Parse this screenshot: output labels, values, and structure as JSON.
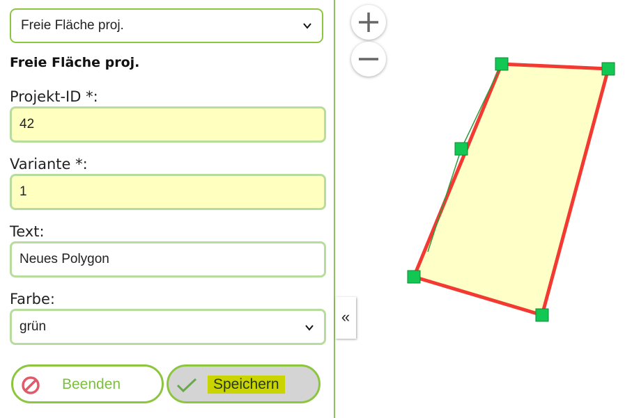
{
  "layer_select": {
    "value": "Freie Fläche proj."
  },
  "form": {
    "title": "Freie Fläche proj.",
    "projekt_id": {
      "label": "Projekt-ID *:",
      "value": "42"
    },
    "variante": {
      "label": "Variante *:",
      "value": "1"
    },
    "text": {
      "label": "Text:",
      "value": "Neues Polygon"
    },
    "farbe": {
      "label": "Farbe:",
      "value": "grün"
    }
  },
  "buttons": {
    "end_label": "Beenden",
    "save_label": "Speichern"
  },
  "map": {
    "collapse_icon": "«",
    "zoom_in_icon": "plus-icon",
    "zoom_out_icon": "minus-icon",
    "polygon": {
      "fill": "#ffffc8",
      "stroke": "#f33a32",
      "vertex_color": "#13c852"
    }
  },
  "colors": {
    "accent": "#8cc63f",
    "required_bg": "#ffffc0",
    "save_highlight": "#c9d400"
  }
}
